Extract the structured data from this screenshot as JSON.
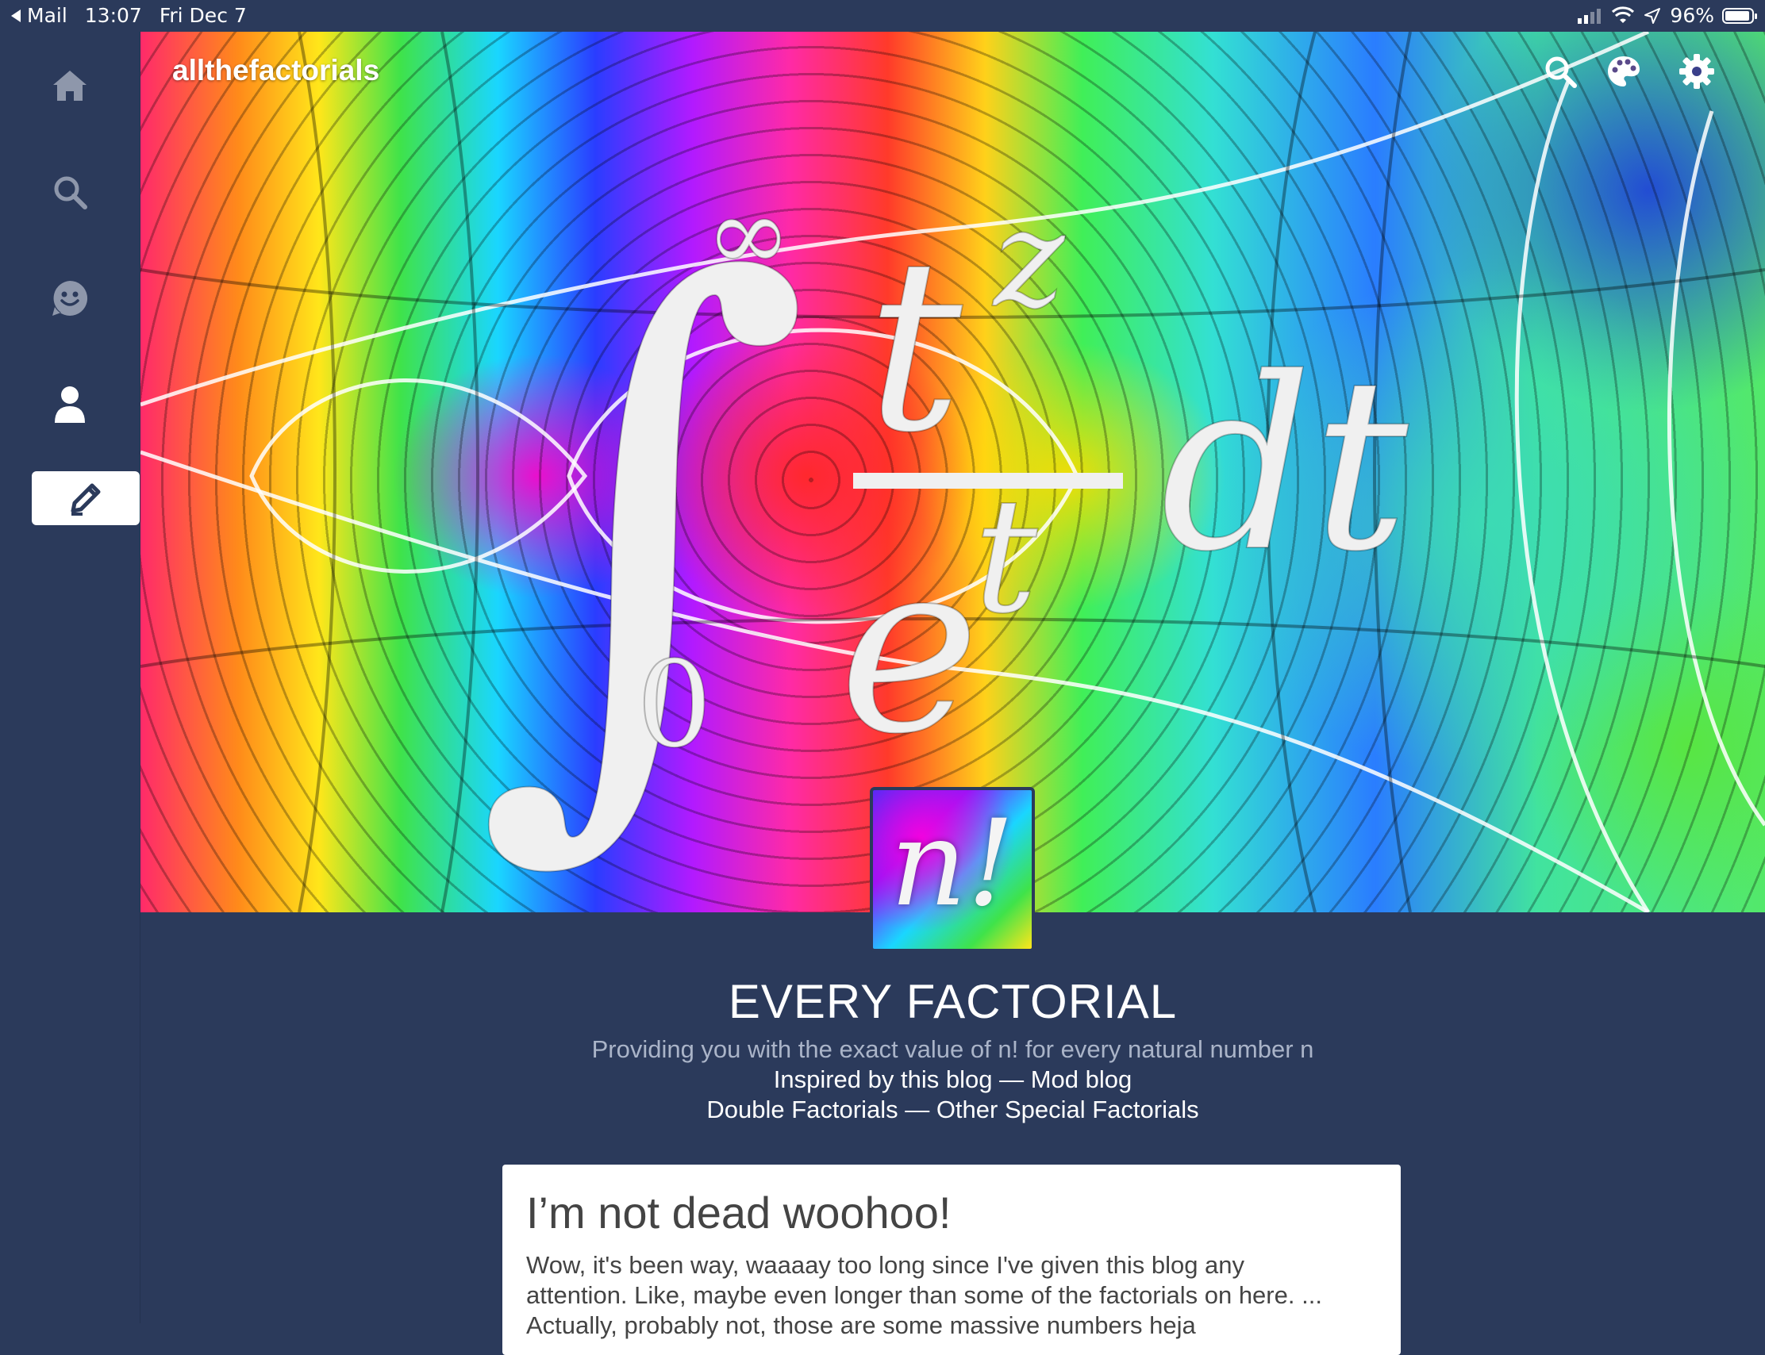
{
  "status_bar": {
    "back_app": "Mail",
    "time": "13:07",
    "date": "Fri Dec 7",
    "battery": "96%"
  },
  "sidebar": {
    "items": [
      {
        "icon": "home-icon"
      },
      {
        "icon": "search-icon"
      },
      {
        "icon": "activity-face-icon"
      },
      {
        "icon": "account-icon"
      },
      {
        "icon": "compose-pencil-icon"
      }
    ]
  },
  "header": {
    "blog_name": "allthefactorials",
    "icons": [
      "search-icon",
      "palette-icon",
      "gear-icon"
    ]
  },
  "banner_formula": {
    "upper_limit": "∞",
    "lower_limit": "0",
    "numerator": "t",
    "numerator_exp": "z",
    "denominator": "e",
    "denominator_exp": "t",
    "differential": "dt"
  },
  "avatar": {
    "text": "n!"
  },
  "blog": {
    "title": "EVERY FACTORIAL",
    "description": "Providing you with the exact value of n! for every natural number n",
    "link_line_1": {
      "a": "Inspired by this blog",
      "sep": " — ",
      "b": "Mod blog"
    },
    "link_line_2": {
      "a": "Double Factorials",
      "sep": " — ",
      "b": "Other Special Factorials"
    }
  },
  "post": {
    "title": "I’m not dead woohoo!",
    "body_line_1": "Wow, it's been way, waaaay too long since I've given this blog any",
    "body_line_2": "attention. Like, maybe even longer than some of the factorials on here. ...",
    "body_line_3": "Actually, probably not, those are some massive numbers heja"
  },
  "colors": {
    "background": "#2b3a5b",
    "card": "#ffffff",
    "text_muted": "#aab4c8"
  }
}
